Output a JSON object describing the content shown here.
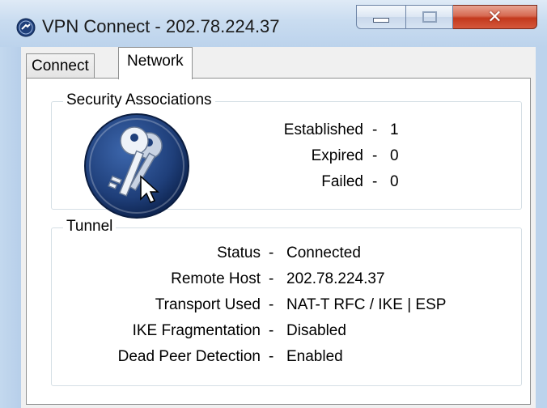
{
  "window": {
    "title": "VPN Connect - 202.78.224.37",
    "icon": "vpn-app-icon",
    "buttons": {
      "minimize": "minimize-icon",
      "maximize": "maximize-icon",
      "close": "close-icon"
    }
  },
  "tabs": [
    {
      "label": "Connect",
      "active": false
    },
    {
      "label": "Network",
      "active": true
    }
  ],
  "security_associations": {
    "title": "Security Associations",
    "icon": "keys-icon",
    "rows": [
      {
        "label": "Established",
        "separator": "-",
        "value": "1"
      },
      {
        "label": "Expired",
        "separator": "-",
        "value": "0"
      },
      {
        "label": "Failed",
        "separator": "-",
        "value": "0"
      }
    ]
  },
  "tunnel": {
    "title": "Tunnel",
    "rows": [
      {
        "label": "Status",
        "separator": "-",
        "value": "Connected"
      },
      {
        "label": "Remote Host",
        "separator": "-",
        "value": "202.78.224.37"
      },
      {
        "label": "Transport Used",
        "separator": "-",
        "value": "NAT-T RFC / IKE | ESP"
      },
      {
        "label": "IKE Fragmentation",
        "separator": "-",
        "value": "Disabled"
      },
      {
        "label": "Dead Peer Detection",
        "separator": "-",
        "value": "Enabled"
      }
    ]
  },
  "colors": {
    "titlebar": "#c9dcf0",
    "close_button": "#c3391d",
    "keys_icon_bg": "#1f3f7a"
  }
}
